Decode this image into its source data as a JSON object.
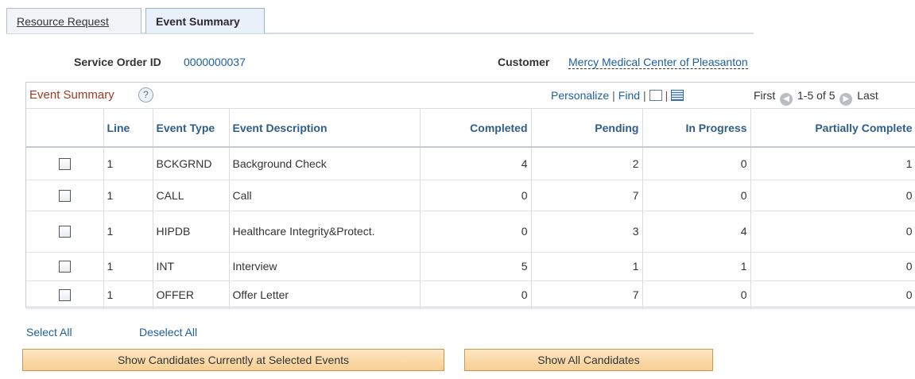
{
  "tabs": [
    {
      "label": "Resource Request",
      "active": false
    },
    {
      "label": "Event Summary",
      "active": true
    }
  ],
  "header": {
    "service_order_label": "Service Order ID",
    "service_order_value": "0000000037",
    "customer_label": "Customer",
    "customer_value": "Mercy Medical Center of Pleasanton"
  },
  "grid": {
    "title": "Event Summary",
    "help_icon": "?",
    "personalize": "Personalize",
    "find": "Find",
    "first": "First",
    "range": "1-5 of 5",
    "last": "Last",
    "columns": [
      "",
      "Line",
      "Event Type",
      "Event Description",
      "Completed",
      "Pending",
      "In Progress",
      "Partially Complete"
    ],
    "rows": [
      {
        "line": "1",
        "type": "BCKGRND",
        "desc": "Background Check",
        "completed": "4",
        "pending": "2",
        "in_progress": "0",
        "partial": "1"
      },
      {
        "line": "1",
        "type": "CALL",
        "desc": "Call",
        "completed": "0",
        "pending": "7",
        "in_progress": "0",
        "partial": "0"
      },
      {
        "line": "1",
        "type": "HIPDB",
        "desc": "Healthcare Integrity&Protect.",
        "completed": "0",
        "pending": "3",
        "in_progress": "4",
        "partial": "0"
      },
      {
        "line": "1",
        "type": "INT",
        "desc": "Interview",
        "completed": "5",
        "pending": "1",
        "in_progress": "1",
        "partial": "0"
      },
      {
        "line": "1",
        "type": "OFFER",
        "desc": "Offer Letter",
        "completed": "0",
        "pending": "7",
        "in_progress": "0",
        "partial": "0"
      }
    ]
  },
  "actions": {
    "select_all": "Select All",
    "deselect_all": "Deselect All",
    "show_selected": "Show Candidates Currently at Selected Events",
    "show_all": "Show All Candidates"
  },
  "colors": {
    "link": "#1d5fa0",
    "grid_title": "#9e3a24",
    "button": "#f7cf93"
  }
}
